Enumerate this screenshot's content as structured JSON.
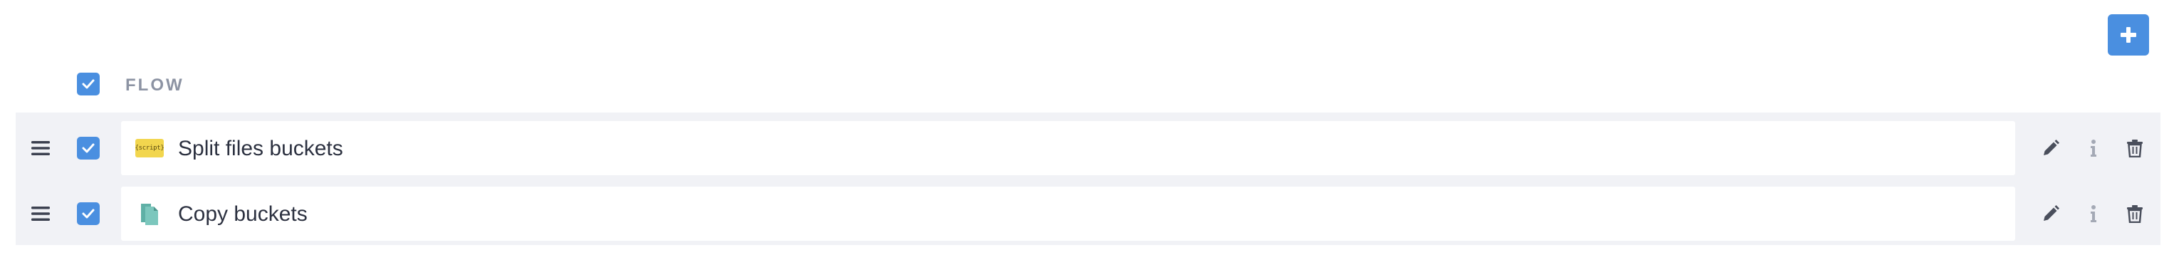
{
  "toolbar": {
    "add_icon": "plus-icon",
    "accent_color": "#4a8fe0"
  },
  "header": {
    "select_all_checked": true,
    "column_label": "FLOW"
  },
  "rows": [
    {
      "name": "Split files buckets",
      "icon": "script-icon",
      "icon_text": "{script}",
      "checked": true
    },
    {
      "name": "Copy buckets",
      "icon": "copy-files-icon",
      "checked": true
    }
  ],
  "row_actions": [
    "pencil-icon",
    "info-icon",
    "trash-icon"
  ]
}
